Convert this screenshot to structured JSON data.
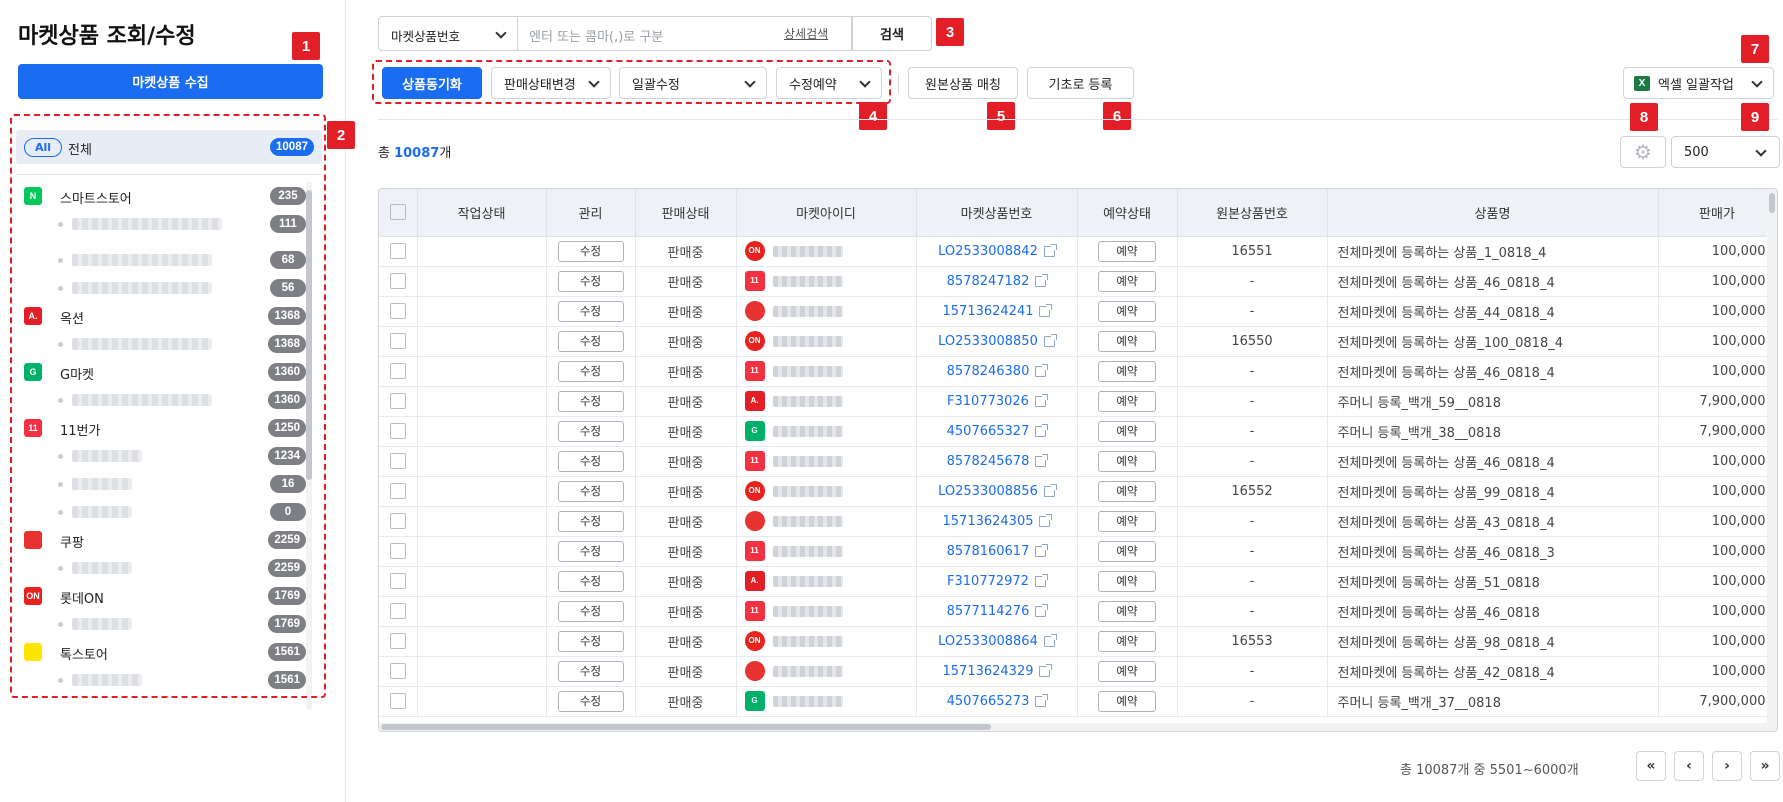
{
  "page_title": "마켓상품 조회/수정",
  "collect_button": "마켓상품 수집",
  "callouts": [
    "1",
    "2",
    "3",
    "4",
    "5",
    "6",
    "7",
    "8",
    "9"
  ],
  "all_filter": {
    "pill": "All",
    "label": "전체",
    "count": "10087"
  },
  "markets": [
    {
      "name": "스마트스토어",
      "count": "235",
      "logo_color": "#03c75a",
      "logo_text": "N",
      "subs": [
        "111",
        "68",
        "56"
      ]
    },
    {
      "name": "옥션",
      "count": "1368",
      "logo_color": "#e21f26",
      "logo_text": "A.",
      "subs": [
        "1368"
      ]
    },
    {
      "name": "G마켓",
      "count": "1360",
      "logo_color": "#00b16a",
      "logo_text": "G",
      "subs": [
        "1360"
      ]
    },
    {
      "name": "11번가",
      "count": "1250",
      "logo_color": "#f43142",
      "logo_text": "11",
      "subs": [
        "1234",
        "16",
        "0"
      ]
    },
    {
      "name": "쿠팡",
      "count": "2259",
      "logo_color": "#e8322f",
      "logo_text": "",
      "subs": [
        "2259"
      ]
    },
    {
      "name": "롯데ON",
      "count": "1769",
      "logo_color": "#e8231f",
      "logo_text": "ON",
      "subs": [
        "1769"
      ]
    },
    {
      "name": "톡스토어",
      "count": "1561",
      "logo_color": "#fee500",
      "logo_text": "",
      "subs": [
        "1561"
      ]
    }
  ],
  "search": {
    "select": "마켓상품번호",
    "placeholder": "엔터 또는 콤마(,)로 구분",
    "detail_link": "상세검색",
    "button": "검색"
  },
  "toolbar": {
    "sync": "상품동기화",
    "status_change": "판매상태변경",
    "bulk_edit": "일괄수정",
    "edit_reserve": "수정예약",
    "match_original": "원본상품 매칭",
    "register_basic": "기초로 등록",
    "excel": "엑셀 일괄작업",
    "excel_icon": "X"
  },
  "total": {
    "prefix": "총 ",
    "count": "10087",
    "suffix": "개"
  },
  "page_size": "500",
  "table": {
    "headers": [
      "작업상태",
      "관리",
      "판매상태",
      "마켓아이디",
      "마켓상품번호",
      "예약상태",
      "원본상품번호",
      "상품명",
      "판매가"
    ],
    "edit_label": "수정",
    "reserve_label": "예약",
    "rows": [
      {
        "status": "판매중",
        "market": "lotte",
        "pid": "LO2533008842",
        "orig": "16551",
        "name": "전체마켓에 등록하는 상품_1_0818_4",
        "price": "100,000"
      },
      {
        "status": "판매중",
        "market": "11st",
        "pid": "8578247182",
        "orig": "-",
        "name": "전체마켓에 등록하는 상품_46_0818_4",
        "price": "100,000"
      },
      {
        "status": "판매중",
        "market": "coupang",
        "pid": "15713624241",
        "orig": "-",
        "name": "전체마켓에 등록하는 상품_44_0818_4",
        "price": "100,000"
      },
      {
        "status": "판매중",
        "market": "lotte",
        "pid": "LO2533008850",
        "orig": "16550",
        "name": "전체마켓에 등록하는 상품_100_0818_4",
        "price": "100,000"
      },
      {
        "status": "판매중",
        "market": "11st",
        "pid": "8578246380",
        "orig": "-",
        "name": "전체마켓에 등록하는 상품_46_0818_4",
        "price": "100,000"
      },
      {
        "status": "판매중",
        "market": "auction",
        "pid": "F310773026",
        "orig": "-",
        "name": "주머니 등록_백개_59__0818",
        "price": "7,900,000"
      },
      {
        "status": "판매중",
        "market": "gmarket",
        "pid": "4507665327",
        "orig": "-",
        "name": "주머니 등록_백개_38__0818",
        "price": "7,900,000"
      },
      {
        "status": "판매중",
        "market": "11st",
        "pid": "8578245678",
        "orig": "-",
        "name": "전체마켓에 등록하는 상품_46_0818_4",
        "price": "100,000"
      },
      {
        "status": "판매중",
        "market": "lotte",
        "pid": "LO2533008856",
        "orig": "16552",
        "name": "전체마켓에 등록하는 상품_99_0818_4",
        "price": "100,000"
      },
      {
        "status": "판매중",
        "market": "coupang",
        "pid": "15713624305",
        "orig": "-",
        "name": "전체마켓에 등록하는 상품_43_0818_4",
        "price": "100,000"
      },
      {
        "status": "판매중",
        "market": "11st",
        "pid": "8578160617",
        "orig": "-",
        "name": "전체마켓에 등록하는 상품_46_0818_3",
        "price": "100,000"
      },
      {
        "status": "판매중",
        "market": "auction",
        "pid": "F310772972",
        "orig": "-",
        "name": "전체마켓에 등록하는 상품_51_0818",
        "price": "100,000"
      },
      {
        "status": "판매중",
        "market": "11st",
        "pid": "8577114276",
        "orig": "-",
        "name": "전체마켓에 등록하는 상품_46_0818",
        "price": "100,000"
      },
      {
        "status": "판매중",
        "market": "lotte",
        "pid": "LO2533008864",
        "orig": "16553",
        "name": "전체마켓에 등록하는 상품_98_0818_4",
        "price": "100,000"
      },
      {
        "status": "판매중",
        "market": "coupang",
        "pid": "15713624329",
        "orig": "-",
        "name": "전체마켓에 등록하는 상품_42_0818_4",
        "price": "100,000"
      },
      {
        "status": "판매중",
        "market": "gmarket",
        "pid": "4507665273",
        "orig": "-",
        "name": "주머니 등록_백개_37__0818",
        "price": "7,900,000"
      }
    ]
  },
  "market_logo_styles": {
    "lotte": {
      "color": "#e8231f",
      "text": "ON",
      "shape": "round"
    },
    "11st": {
      "color": "#f43142",
      "text": "11",
      "shape": "square"
    },
    "coupang": {
      "color": "#e8322f",
      "text": "",
      "shape": "round"
    },
    "auction": {
      "color": "#e21f26",
      "text": "A.",
      "shape": "square"
    },
    "gmarket": {
      "color": "#00b16a",
      "text": "G",
      "shape": "square"
    }
  },
  "pagination": {
    "info": "총 10087개 중 5501~6000개",
    "first": "«",
    "prev": "‹",
    "next": "›",
    "last": "»"
  }
}
